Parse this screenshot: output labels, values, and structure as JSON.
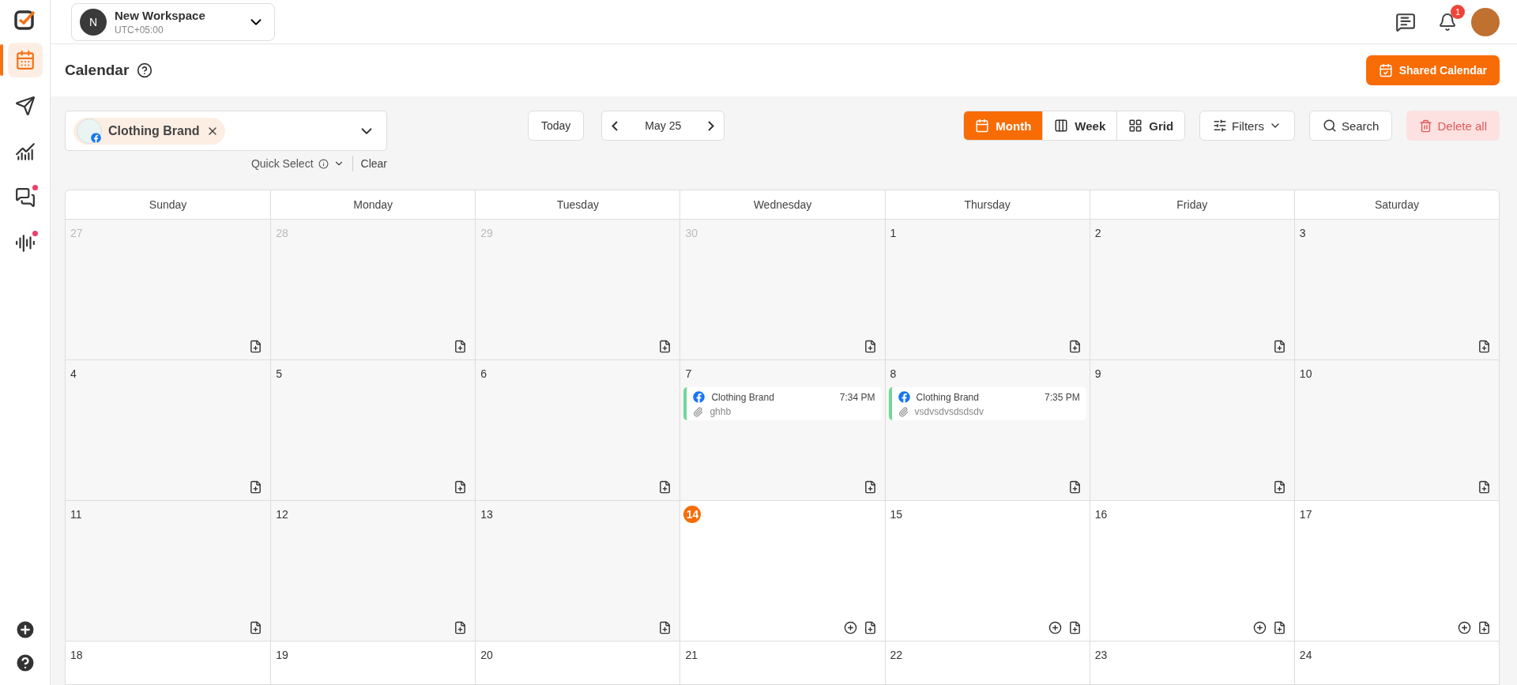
{
  "sidebar": {
    "items": [
      {
        "kind": "calendar",
        "selected": true,
        "dot": false
      },
      {
        "kind": "send",
        "selected": false,
        "dot": false
      },
      {
        "kind": "analytics",
        "selected": false,
        "dot": false
      },
      {
        "kind": "chat",
        "selected": false,
        "dot": true
      },
      {
        "kind": "audio",
        "selected": false,
        "dot": true
      }
    ]
  },
  "workspace": {
    "initial": "N",
    "name": "New Workspace",
    "timezone": "UTC+05:00"
  },
  "notifications": {
    "count": "1"
  },
  "page": {
    "title": "Calendar",
    "shared_button": "Shared Calendar"
  },
  "account_select": {
    "chip": "Clothing Brand",
    "quick_select": "Quick Select",
    "clear": "Clear"
  },
  "navigation": {
    "today": "Today",
    "period": "May 25"
  },
  "views": [
    {
      "kind": "month",
      "label": "Month",
      "selected": true
    },
    {
      "kind": "week",
      "label": "Week",
      "selected": false
    },
    {
      "kind": "grid",
      "label": "Grid",
      "selected": false
    }
  ],
  "filters": "Filters",
  "search": "Search",
  "delete_all": "Delete all",
  "weekdays": [
    "Sunday",
    "Monday",
    "Tuesday",
    "Wednesday",
    "Thursday",
    "Friday",
    "Saturday"
  ],
  "weeks": [
    [
      {
        "date": "27",
        "outside": true,
        "past": true,
        "today": false
      },
      {
        "date": "28",
        "outside": true,
        "past": true,
        "today": false
      },
      {
        "date": "29",
        "outside": true,
        "past": true,
        "today": false
      },
      {
        "date": "30",
        "outside": true,
        "past": true,
        "today": false
      },
      {
        "date": "1",
        "outside": false,
        "past": true,
        "today": false
      },
      {
        "date": "2",
        "outside": false,
        "past": true,
        "today": false
      },
      {
        "date": "3",
        "outside": false,
        "past": true,
        "today": false
      }
    ],
    [
      {
        "date": "4",
        "outside": false,
        "past": true,
        "today": false
      },
      {
        "date": "5",
        "outside": false,
        "past": true,
        "today": false
      },
      {
        "date": "6",
        "outside": false,
        "past": true,
        "today": false
      },
      {
        "date": "7",
        "outside": false,
        "past": true,
        "today": false,
        "events": [
          {
            "account": "Clothing Brand",
            "time": "7:34 PM",
            "text": "ghhb"
          }
        ]
      },
      {
        "date": "8",
        "outside": false,
        "past": true,
        "today": false,
        "events": [
          {
            "account": "Clothing Brand",
            "time": "7:35 PM",
            "text": "vsdvsdvsdsdsdv"
          }
        ]
      },
      {
        "date": "9",
        "outside": false,
        "past": true,
        "today": false
      },
      {
        "date": "10",
        "outside": false,
        "past": true,
        "today": false
      }
    ],
    [
      {
        "date": "11",
        "outside": false,
        "past": true,
        "today": false
      },
      {
        "date": "12",
        "outside": false,
        "past": true,
        "today": false
      },
      {
        "date": "13",
        "outside": false,
        "past": true,
        "today": false
      },
      {
        "date": "14",
        "outside": false,
        "past": false,
        "today": true
      },
      {
        "date": "15",
        "outside": false,
        "past": false,
        "today": false
      },
      {
        "date": "16",
        "outside": false,
        "past": false,
        "today": false
      },
      {
        "date": "17",
        "outside": false,
        "past": false,
        "today": false
      }
    ],
    [
      {
        "date": "18",
        "outside": false,
        "today": false
      },
      {
        "date": "19",
        "outside": false,
        "today": false
      },
      {
        "date": "20",
        "outside": false,
        "today": false
      },
      {
        "date": "21",
        "outside": false,
        "today": false
      },
      {
        "date": "22",
        "outside": false,
        "today": false
      },
      {
        "date": "23",
        "outside": false,
        "today": false
      },
      {
        "date": "24",
        "outside": false,
        "today": false
      }
    ]
  ]
}
